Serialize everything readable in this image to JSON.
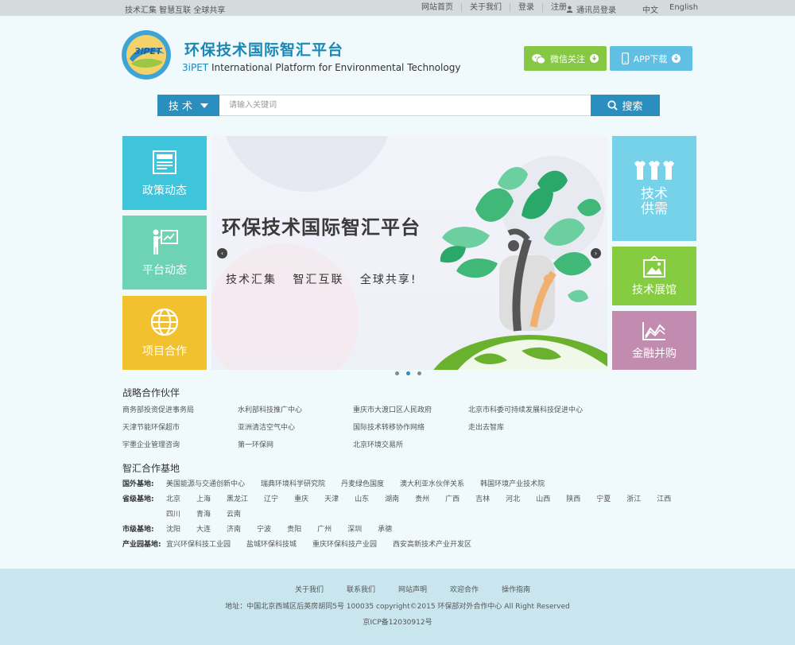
{
  "topbar": {
    "slogan": "技术汇集 智慧互联 全球共享",
    "links": [
      "网站首页",
      "关于我们",
      "登录",
      "注册"
    ],
    "member_login": "通讯员登录",
    "lang_cn": "中文",
    "lang_en": "English"
  },
  "header": {
    "logo_text": "3iPET",
    "title": "环保技术国际智汇平台",
    "subtitle_brand": "3iPET",
    "subtitle_text": " International Platform for Environmental Technology",
    "wechat_label": "微信关注",
    "app_label": "APP下载"
  },
  "search": {
    "category": "技 术",
    "placeholder": "请输入关键词",
    "button": "搜索"
  },
  "tiles": {
    "policy": "政策动态",
    "platform": "平台动态",
    "project": "项目合作",
    "supply": [
      "技术",
      "供需"
    ],
    "exhibit": "技术展馆",
    "finance": "金融并购"
  },
  "banner": {
    "title": "环保技术国际智汇平台",
    "subtitle": "技术汇集 智汇互联 全球共享!"
  },
  "partners": {
    "title": "战略合作伙伴",
    "items": [
      "商务部投资促进事务局",
      "水利部科技推广中心",
      "重庆市大渡口区人民政府",
      "北京市科委可持续发展科技促进中心",
      "天津节能环保超市",
      "亚洲清洁空气中心",
      "国际技术转移协作网络",
      "走出去智库",
      "宇墨企业管理咨询",
      "第一环保网",
      "北京环境交易所"
    ]
  },
  "bases": {
    "title": "智汇合作基地",
    "rows": [
      {
        "label": "国外基地:",
        "items": [
          "美国能源与交通创新中心",
          "瑞典环境科学研究院",
          "丹麦绿色国度",
          "澳大利亚水伙伴关系",
          "韩国环境产业技术院"
        ]
      },
      {
        "label": "省级基地:",
        "items": [
          "北京",
          "上海",
          "黑龙江",
          "辽宁",
          "重庆",
          "天津",
          "山东",
          "湖南",
          "贵州",
          "广西",
          "吉林",
          "河北",
          "山西",
          "陕西",
          "宁夏",
          "浙江",
          "江西",
          "四川",
          "青海",
          "云南"
        ]
      },
      {
        "label": "市级基地:",
        "items": [
          "沈阳",
          "大连",
          "济南",
          "宁波",
          "贵阳",
          "广州",
          "深圳",
          "承德"
        ]
      },
      {
        "label": "产业园基地:",
        "items": [
          "宜兴环保科技工业园",
          "盐城环保科技城",
          "重庆环保科技产业园",
          "西安高新技术产业开发区"
        ]
      }
    ]
  },
  "footer": {
    "links": [
      "关于我们",
      "联系我们",
      "网站声明",
      "欢迎合作",
      "操作指南"
    ],
    "address": "地址：中国北京西城区后英房胡同5号 100035 copyright©2015 环保部对外合作中心 All Right Reserved",
    "icp": "京ICP备12030912号"
  },
  "colors": {
    "accent": "#2a8fbf",
    "title_blue": "#1a88b5",
    "wechat_green": "#86c843",
    "app_blue": "#5fc0e3"
  }
}
